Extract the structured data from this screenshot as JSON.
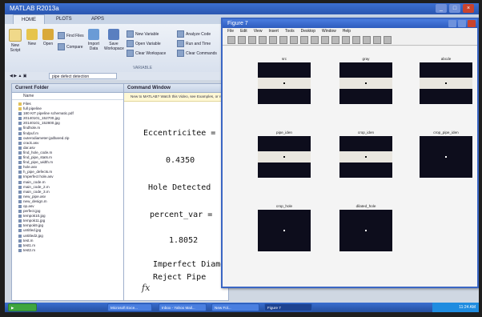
{
  "matlab": {
    "title": "MATLAB R2013a",
    "tabs": [
      "HOME",
      "PLOTS",
      "APPS"
    ],
    "ribbon_buttons": [
      "New Script",
      "New",
      "Open",
      "Find Files",
      "Compare",
      "Import Data",
      "Save Workspace"
    ],
    "ribbon_small": [
      "New Variable",
      "Open Variable",
      "Clear Workspace",
      "Analyze Code",
      "Run and Time",
      "Clear Commands"
    ],
    "section_label": "VARIABLE",
    "path": "pipe defect detection"
  },
  "current_folder": {
    "title": "Current Folder",
    "column": "Name",
    "items": [
      "Files",
      "full pipeline",
      "180 KIT pipeline schematic.pdf",
      "20140101_152700.jpg",
      "20140101_152800.jpg",
      "findhole.m",
      "findpuf.m",
      "outerodiameter-jpdbared.zip",
      "crack.asv",
      "dar.asv",
      "find_hole_code.m",
      "find_pipe_stats.m",
      "find_pipe_width.m",
      "hole.asv",
      "h_pipe_defects.m",
      "Imperfect hole.asv",
      "main_code.m",
      "main_code_2.m",
      "main_code_3.m",
      "new_pipe.asv",
      "new_design.m",
      "op.asv",
      "perfect.jpg",
      "tempok10.jpg",
      "tempok11.jpg",
      "tempok9.jpg",
      "untitled.jpg",
      "untitled2.jpg",
      "test.m",
      "test1.m",
      "test2.m"
    ]
  },
  "command_window": {
    "title": "Command Window",
    "info": "New to MATLAB? Watch this Video, see Examples, or read Getting Started.",
    "lines": [
      "Eccentricitee =",
      "0.4350",
      "Hole Detected",
      "percent_var =",
      "1.8052",
      "Imperfect Diameter",
      "Reject Pipe"
    ],
    "prompt": "fx"
  },
  "figure": {
    "title": "Figure 7",
    "menu": [
      "File",
      "Edit",
      "View",
      "Insert",
      "Tools",
      "Desktop",
      "Window",
      "Help"
    ],
    "subplots": [
      {
        "title": "src",
        "band": true,
        "dot": "dark"
      },
      {
        "title": "gray",
        "band": true,
        "dot": "dark"
      },
      {
        "title": "abcde",
        "band": true,
        "dot": "dark"
      },
      {
        "title": "pipe_iden",
        "band": true,
        "dot": "dark"
      },
      {
        "title": "crop_iden",
        "band": true,
        "dot": "dark"
      },
      {
        "title": "crop_pipe_iden",
        "band": false,
        "dot": "light"
      },
      {
        "title": "crop_hole",
        "band": false,
        "dot": "light"
      },
      {
        "title": "dilated_hole",
        "band": false,
        "dot": "light"
      }
    ]
  },
  "taskbar": {
    "tasks": [
      "Microsoft Exce...",
      "Inbox - Yahoo Mail...",
      "New Fol...",
      "Figure 7"
    ],
    "tray": "11:24 AM"
  }
}
